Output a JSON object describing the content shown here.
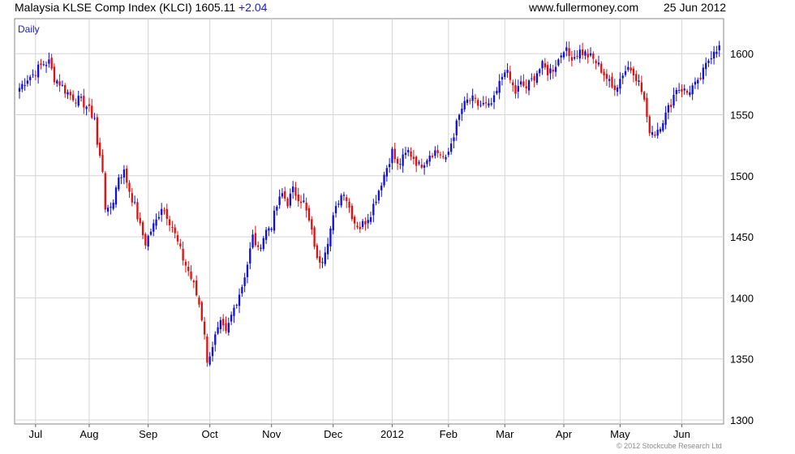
{
  "header": {
    "index_name": "Malaysia KLSE Comp Index (KLCI)",
    "last_value": "1605.11",
    "change": "+2.04",
    "website": "www.fullermoney.com",
    "date": "25 Jun 2012"
  },
  "footer": {
    "copyright": "© 2012 Stockcube Research Ltd"
  },
  "colors": {
    "up": "#1010d8",
    "down": "#e01010",
    "grid": "#d4d4d4",
    "axis": "#888888"
  },
  "chart_data": {
    "type": "candlestick",
    "period_label": "Daily",
    "ylim": [
      1300,
      1625
    ],
    "y_ticks": [
      1300,
      1350,
      1400,
      1450,
      1500,
      1550,
      1600
    ],
    "x_ticks": [
      "Jul",
      "Aug",
      "Sep",
      "Oct",
      "Nov",
      "Dec",
      "2012",
      "Feb",
      "Mar",
      "Apr",
      "May",
      "Jun"
    ],
    "x_tick_positions": [
      6,
      26,
      48,
      71,
      94,
      117,
      139,
      160,
      181,
      203,
      224,
      247
    ],
    "bar_count": 262,
    "grid": true,
    "series": [
      {
        "values": [
          [
            0,
            1572
          ],
          [
            3,
            1580
          ],
          [
            5,
            1583
          ],
          [
            7,
            1588
          ],
          [
            9,
            1592
          ],
          [
            11,
            1593
          ],
          [
            13,
            1580
          ],
          [
            15,
            1576
          ],
          [
            17,
            1570
          ],
          [
            19,
            1566
          ],
          [
            21,
            1563
          ],
          [
            23,
            1561
          ],
          [
            25,
            1557
          ],
          [
            27,
            1550
          ],
          [
            28,
            1548
          ],
          [
            29,
            1525
          ],
          [
            31,
            1505
          ],
          [
            32,
            1475
          ],
          [
            33,
            1470
          ],
          [
            35,
            1480
          ],
          [
            37,
            1500
          ],
          [
            39,
            1503
          ],
          [
            41,
            1488
          ],
          [
            43,
            1475
          ],
          [
            45,
            1458
          ],
          [
            47,
            1445
          ],
          [
            49,
            1455
          ],
          [
            51,
            1463
          ],
          [
            53,
            1475
          ],
          [
            55,
            1468
          ],
          [
            57,
            1458
          ],
          [
            59,
            1445
          ],
          [
            61,
            1432
          ],
          [
            63,
            1422
          ],
          [
            65,
            1410
          ],
          [
            67,
            1395
          ],
          [
            69,
            1372
          ],
          [
            70,
            1345
          ],
          [
            71,
            1355
          ],
          [
            73,
            1368
          ],
          [
            75,
            1378
          ],
          [
            77,
            1370
          ],
          [
            79,
            1385
          ],
          [
            81,
            1398
          ],
          [
            83,
            1410
          ],
          [
            85,
            1428
          ],
          [
            87,
            1450
          ],
          [
            88,
            1445
          ],
          [
            89,
            1438
          ],
          [
            90,
            1445
          ],
          [
            92,
            1455
          ],
          [
            94,
            1460
          ],
          [
            96,
            1475
          ],
          [
            98,
            1485
          ],
          [
            100,
            1478
          ],
          [
            102,
            1488
          ],
          [
            104,
            1483
          ],
          [
            106,
            1478
          ],
          [
            108,
            1462
          ],
          [
            110,
            1444
          ],
          [
            111,
            1430
          ],
          [
            113,
            1433
          ],
          [
            115,
            1448
          ],
          [
            117,
            1465
          ],
          [
            119,
            1480
          ],
          [
            121,
            1488
          ],
          [
            123,
            1474
          ],
          [
            125,
            1462
          ],
          [
            127,
            1458
          ],
          [
            129,
            1463
          ],
          [
            131,
            1470
          ],
          [
            133,
            1482
          ],
          [
            135,
            1495
          ],
          [
            137,
            1507
          ],
          [
            139,
            1520
          ],
          [
            141,
            1508
          ],
          [
            143,
            1514
          ],
          [
            145,
            1520
          ],
          [
            147,
            1515
          ],
          [
            149,
            1508
          ],
          [
            151,
            1512
          ],
          [
            153,
            1518
          ],
          [
            155,
            1520
          ],
          [
            157,
            1518
          ],
          [
            159,
            1512
          ],
          [
            161,
            1527
          ],
          [
            163,
            1542
          ],
          [
            165,
            1555
          ],
          [
            167,
            1561
          ],
          [
            169,
            1562
          ],
          [
            171,
            1558
          ],
          [
            173,
            1558
          ],
          [
            175,
            1556
          ],
          [
            177,
            1562
          ],
          [
            179,
            1575
          ],
          [
            181,
            1588
          ],
          [
            183,
            1578
          ],
          [
            185,
            1568
          ],
          [
            187,
            1575
          ],
          [
            189,
            1572
          ],
          [
            191,
            1578
          ],
          [
            193,
            1585
          ],
          [
            195,
            1590
          ],
          [
            197,
            1585
          ],
          [
            199,
            1588
          ],
          [
            201,
            1595
          ],
          [
            203,
            1605
          ],
          [
            205,
            1598
          ],
          [
            207,
            1598
          ],
          [
            209,
            1602
          ],
          [
            211,
            1600
          ],
          [
            213,
            1597
          ],
          [
            215,
            1593
          ],
          [
            217,
            1587
          ],
          [
            219,
            1580
          ],
          [
            221,
            1572
          ],
          [
            223,
            1575
          ],
          [
            225,
            1584
          ],
          [
            227,
            1589
          ],
          [
            229,
            1586
          ],
          [
            231,
            1576
          ],
          [
            233,
            1562
          ],
          [
            234,
            1545
          ],
          [
            235,
            1538
          ],
          [
            237,
            1535
          ],
          [
            239,
            1542
          ],
          [
            241,
            1550
          ],
          [
            243,
            1560
          ],
          [
            245,
            1572
          ],
          [
            247,
            1571
          ],
          [
            249,
            1568
          ],
          [
            251,
            1573
          ],
          [
            253,
            1575
          ],
          [
            255,
            1585
          ],
          [
            257,
            1595
          ],
          [
            259,
            1604
          ],
          [
            261,
            1605
          ]
        ]
      }
    ]
  }
}
